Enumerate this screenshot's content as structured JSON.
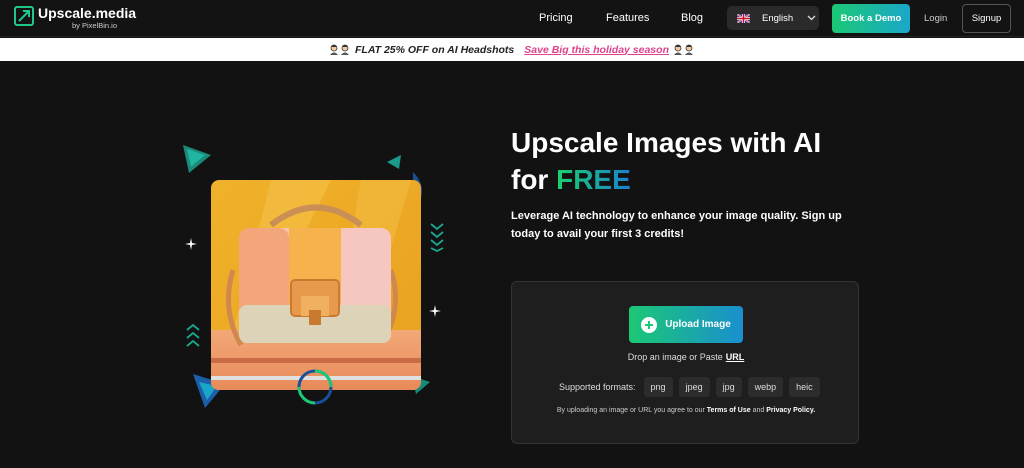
{
  "nav": {
    "logo_title": "Upscale.media",
    "logo_sub": "by PixelBin.io",
    "links": [
      "Pricing",
      "Features",
      "Blog"
    ],
    "language": "English",
    "demo_label": "Book a Demo",
    "login_label": "Login",
    "signup_label": "Signup"
  },
  "promo": {
    "text": "FLAT 25% OFF on AI Headshots",
    "link": "Save Big this holiday season"
  },
  "hero": {
    "title_line1": "Upscale Images with AI",
    "title_for": "for",
    "title_free": "FREE",
    "subtitle": "Leverage AI technology to enhance your image quality. Sign up today to avail your first 3 credits!"
  },
  "upload": {
    "button_label": "Upload Image",
    "drop_text": "Drop an image or Paste",
    "drop_url": "URL",
    "formats_label": "Supported formats:",
    "formats": [
      "png",
      "jpeg",
      "jpg",
      "webp",
      "heic"
    ],
    "terms_prefix": "By uploading an image or URL you agree to our",
    "terms_link": "Terms of Use",
    "terms_and": "and",
    "privacy_link": "Privacy Policy."
  },
  "colors": {
    "accent_green": "#1bc874",
    "accent_blue": "#1a8fcf",
    "promo_pink": "#e0428e",
    "background": "#121212"
  }
}
